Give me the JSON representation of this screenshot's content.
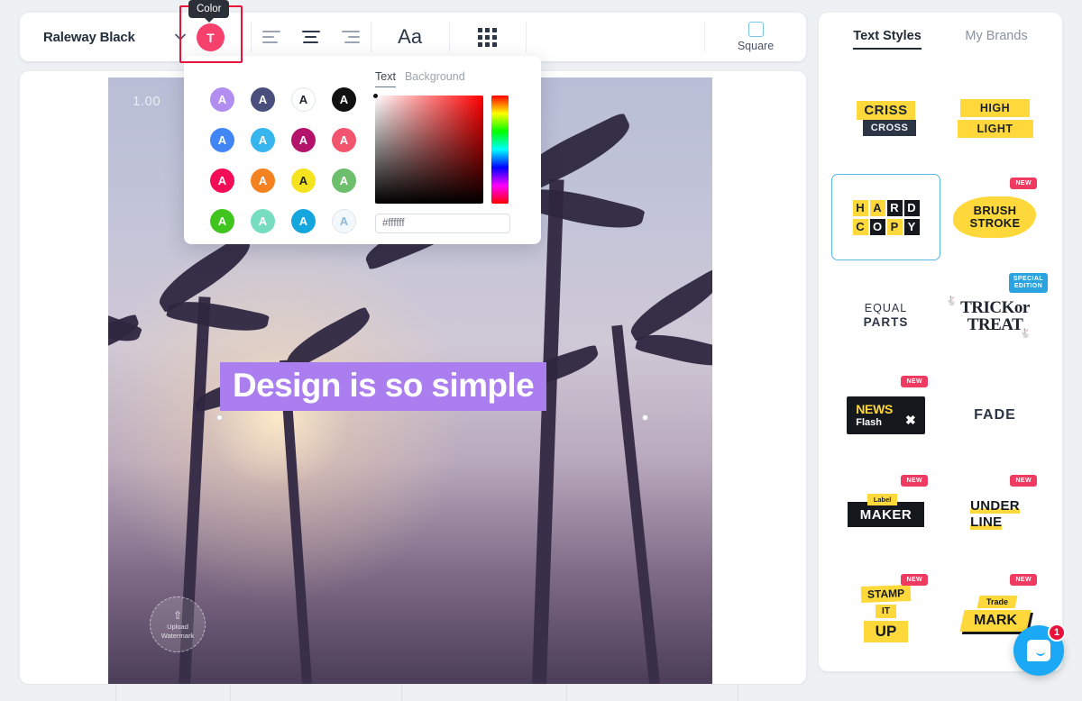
{
  "toolbar": {
    "font_name": "Raleway Black",
    "chevron_icon": "chevron-down-icon",
    "align_left": "align-left-icon",
    "align_center": "align-center-icon",
    "align_right": "align-right-icon",
    "text_size_label": "Aa",
    "grid_icon": "grid-icon",
    "shape_label": "Square",
    "color_letter": "T",
    "color_tooltip": "Color",
    "color_accent": "#f5416c",
    "highlight_border": "#e8133a"
  },
  "color_popover": {
    "tabs": [
      {
        "label": "Text",
        "active": true
      },
      {
        "label": "Background",
        "active": false
      }
    ],
    "hex_value": "#ffffff",
    "swatches": [
      {
        "color": "#b28ef0",
        "letter": "A",
        "letter_color": "#ffffff",
        "bordered": false
      },
      {
        "color": "#4a4e7c",
        "letter": "A",
        "letter_color": "#ffffff",
        "bordered": false
      },
      {
        "color": "#ffffff",
        "letter": "A",
        "letter_color": "#1d232c",
        "bordered": true
      },
      {
        "color": "#111111",
        "letter": "A",
        "letter_color": "#ffffff",
        "bordered": false
      },
      {
        "color": "#4285f4",
        "letter": "A",
        "letter_color": "#ffffff",
        "bordered": false
      },
      {
        "color": "#36b5ef",
        "letter": "A",
        "letter_color": "#ffffff",
        "bordered": false
      },
      {
        "color": "#b4136b",
        "letter": "A",
        "letter_color": "#ffffff",
        "bordered": false
      },
      {
        "color": "#f4556e",
        "letter": "A",
        "letter_color": "#ffffff",
        "bordered": false
      },
      {
        "color": "#f20d56",
        "letter": "A",
        "letter_color": "#ffffff",
        "bordered": false
      },
      {
        "color": "#f58220",
        "letter": "A",
        "letter_color": "#ffffff",
        "bordered": false
      },
      {
        "color": "#f5e320",
        "letter": "A",
        "letter_color": "#1d232c",
        "bordered": false
      },
      {
        "color": "#6dbf6d",
        "letter": "A",
        "letter_color": "#ffffff",
        "bordered": false
      },
      {
        "color": "#3fc51e",
        "letter": "A",
        "letter_color": "#ffffff",
        "bordered": false
      },
      {
        "color": "#77ddc0",
        "letter": "A",
        "letter_color": "#ffffff",
        "bordered": false
      },
      {
        "color": "#14a6dd",
        "letter": "A",
        "letter_color": "#ffffff",
        "bordered": false
      },
      {
        "color": "#f2f8fc",
        "letter": "A",
        "letter_color": "#8fb8d6",
        "bordered": true
      }
    ]
  },
  "canvas": {
    "zoom_level": "1.00",
    "headline_text": "Design is so simple",
    "headline_bg": "#ab7ef0",
    "headline_color": "#ffffff",
    "watermark_line1": "Upload",
    "watermark_line2": "Watermark",
    "watermark_icon": "upload-arrow-icon"
  },
  "right_panel": {
    "tabs": [
      {
        "label": "Text Styles",
        "active": true
      },
      {
        "label": "My Brands",
        "active": false
      }
    ],
    "styles": [
      {
        "id": "criss-cross",
        "line1": "CRISS",
        "line2": "CROSS",
        "badge": "",
        "selected": false
      },
      {
        "id": "high-light",
        "line1": "HIGH",
        "line2": "LIGHT",
        "badge": "",
        "selected": false
      },
      {
        "id": "hard-copy",
        "line1": "HARD",
        "line2": "COPY",
        "badge": "",
        "selected": true
      },
      {
        "id": "brush-stroke",
        "line1": "BRUSH",
        "line2": "STROKE",
        "badge": "NEW",
        "selected": false
      },
      {
        "id": "equal-parts",
        "line1": "EQUAL",
        "line2": "PARTS",
        "badge": "",
        "selected": false
      },
      {
        "id": "trick-or-treat",
        "line1": "TRICKor",
        "line2": "TREAT",
        "badge": "SPECIAL EDITION",
        "selected": false
      },
      {
        "id": "news-flash",
        "line1": "NEWS",
        "line2": "Flash",
        "badge": "NEW",
        "selected": false
      },
      {
        "id": "fade",
        "line1": "FADE",
        "line2": "",
        "badge": "",
        "selected": false
      },
      {
        "id": "label-maker",
        "line1": "Label",
        "line2": "MAKER",
        "badge": "NEW",
        "selected": false
      },
      {
        "id": "under-line",
        "line1": "UNDER",
        "line2": "LINE",
        "badge": "NEW",
        "selected": false
      },
      {
        "id": "stamp-it-up",
        "line1": "STAMP",
        "line2": "IT",
        "line3": "UP",
        "badge": "NEW",
        "selected": false
      },
      {
        "id": "trade-mark",
        "line1": "Trade",
        "line2": "MARK",
        "badge": "NEW",
        "selected": false
      }
    ]
  },
  "chat": {
    "unread_count": "1",
    "icon": "chat-bubble-icon"
  }
}
